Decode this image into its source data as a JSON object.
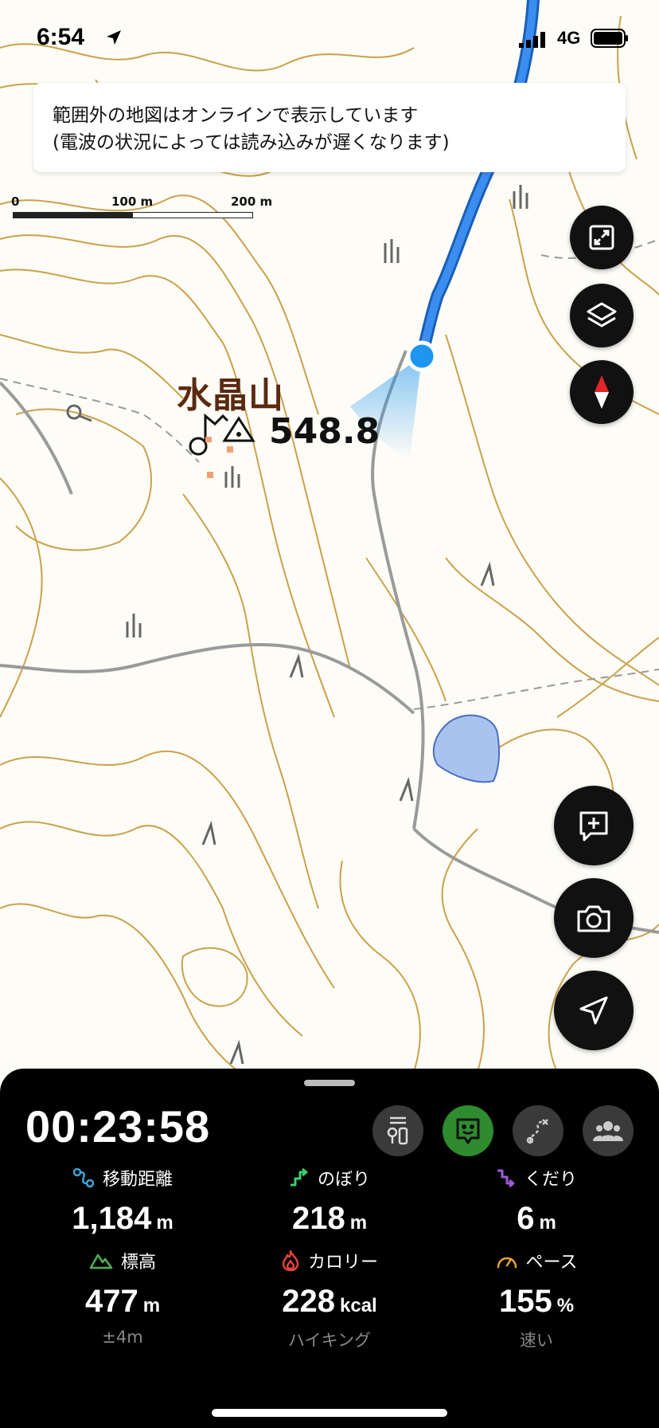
{
  "status_bar": {
    "time": "6:54",
    "network": "4G"
  },
  "notice": {
    "line1": "範囲外の地図はオンラインで表示しています",
    "line2": "(電波の状況によっては読み込みが遅くなります)"
  },
  "scale": {
    "zero": "0",
    "mid": "100 m",
    "max": "200 m"
  },
  "map": {
    "peak_name": "水晶山",
    "peak_elevation": "548.8",
    "colors": {
      "contour": "#c9a24a",
      "trail": "#2f7ddc",
      "road": "#9a9a9a",
      "pond": "#a9c3f0",
      "location": "#1e96f0"
    }
  },
  "map_controls": [
    {
      "name": "expand-button",
      "icon": "expand-icon"
    },
    {
      "name": "layers-button",
      "icon": "layers-icon"
    },
    {
      "name": "compass-button",
      "icon": "compass-icon"
    }
  ],
  "action_buttons": [
    {
      "name": "add-memo-button",
      "icon": "add-memo-icon"
    },
    {
      "name": "camera-button",
      "icon": "camera-icon"
    },
    {
      "name": "locate-button",
      "icon": "navigation-arrow-icon"
    }
  ],
  "panel": {
    "elapsed": "00:23:58",
    "stats": {
      "distance": {
        "label": "移動距離",
        "value": "1,184",
        "unit": "m",
        "icon_color": "#3aa6d8"
      },
      "ascent": {
        "label": "のぼり",
        "value": "218",
        "unit": "m",
        "icon_color": "#3ccf6b"
      },
      "descent": {
        "label": "くだり",
        "value": "6",
        "unit": "m",
        "icon_color": "#9a5bd8"
      },
      "altitude": {
        "label": "標高",
        "value": "477",
        "unit": "m",
        "sub": "±4m",
        "icon_color": "#4fae5a"
      },
      "calorie": {
        "label": "カロリー",
        "value": "228",
        "unit": "kcal",
        "sub": "ハイキング",
        "icon_color": "#e0443a"
      },
      "pace": {
        "label": "ペース",
        "value": "155",
        "unit": "%",
        "sub": "速い",
        "icon_color": "#e8a33a"
      }
    }
  }
}
